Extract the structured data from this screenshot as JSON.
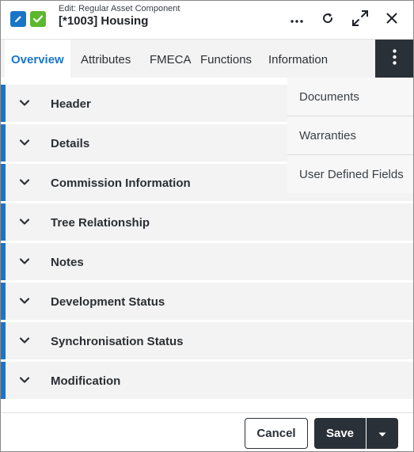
{
  "window": {
    "subtitle": "Edit: Regular Asset Component",
    "title": "[*1003] Housing"
  },
  "header_icons": [
    "pencil-icon",
    "check-icon",
    "ellipsis-icon",
    "refresh-icon",
    "expand-icon",
    "close-icon"
  ],
  "tabs": [
    {
      "label": "Overview",
      "active": true
    },
    {
      "label": "Attributes"
    },
    {
      "label": "FMECA"
    },
    {
      "label": "Functions"
    },
    {
      "label": "Information"
    }
  ],
  "overflow_menu": {
    "items": [
      {
        "label": "Documents"
      },
      {
        "label": "Warranties"
      },
      {
        "label": "User Defined Fields"
      }
    ]
  },
  "sections": [
    {
      "label": "Header"
    },
    {
      "label": "Details"
    },
    {
      "label": "Commission Information"
    },
    {
      "label": "Tree Relationship"
    },
    {
      "label": "Notes"
    },
    {
      "label": "Development Status"
    },
    {
      "label": "Synchronisation Status"
    },
    {
      "label": "Modification"
    }
  ],
  "footer": {
    "cancel_label": "Cancel",
    "save_label": "Save"
  },
  "colors": {
    "accent": "#1a75c7",
    "success": "#5cb82e",
    "dark": "#2a3038",
    "section_bg": "#f3f3f3"
  }
}
